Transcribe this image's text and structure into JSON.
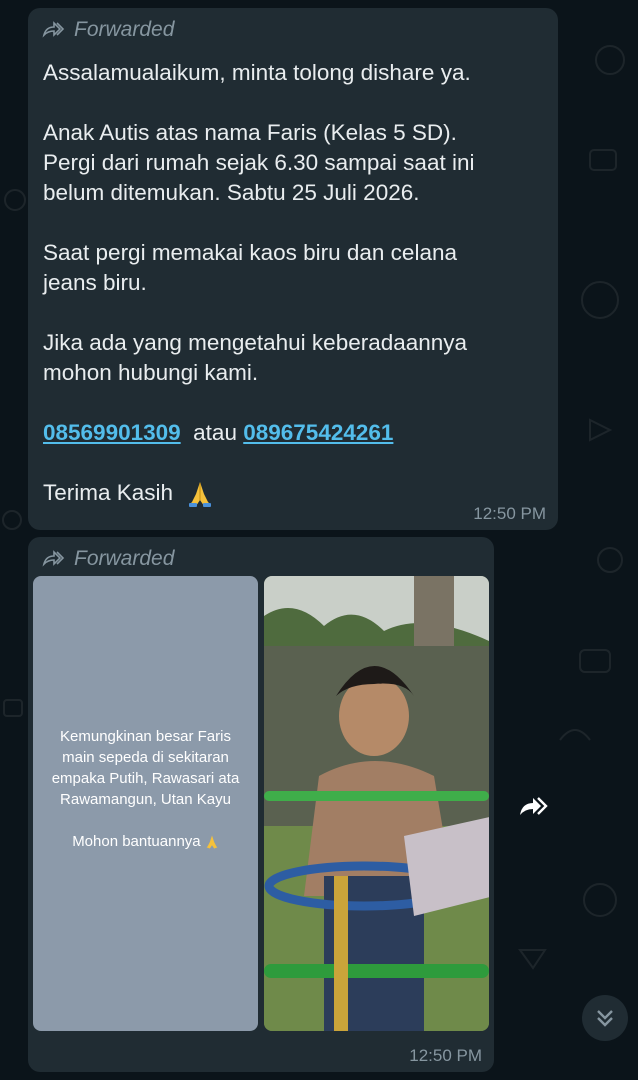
{
  "messages": [
    {
      "forwarded_label": "Forwarded",
      "lines": [
        "Assalamualaikum, minta tolong dishare ya.",
        "",
        "Anak Autis atas nama Faris (Kelas 5 SD).",
        "Pergi dari rumah sejak 6.30 sampai saat ini",
        "belum ditemukan. Sabtu 25 Juli 2026.",
        "",
        "Saat pergi memakai kaos biru dan celana",
        "jeans biru.",
        "",
        "Jika ada yang mengetahui keberadaannya",
        "mohon hubungi kami."
      ],
      "phone_1": "08569901309",
      "phone_separator": "atau",
      "phone_2": "089675424261",
      "closing": "Terima Kasih",
      "time": "12:50 PM"
    },
    {
      "forwarded_label": "Forwarded",
      "caption_lines": [
        "Kemungkinan besar Faris",
        "main sepeda di sekitaran",
        "empaka Putih, Rawasari ata",
        "Rawamangun, Utan Kayu",
        "",
        "Mohon bantuannya"
      ],
      "time": "12:50 PM"
    }
  ],
  "icons": {
    "forwarded": "forward-arrows-icon",
    "pray": "praying-hands-emoji",
    "share": "forward-share-icon",
    "scroll_down": "double-chevron-down-icon"
  },
  "colors": {
    "background": "#0b141a",
    "bubble": "#202c33",
    "link": "#53bdeb",
    "meta": "#8696a0"
  }
}
